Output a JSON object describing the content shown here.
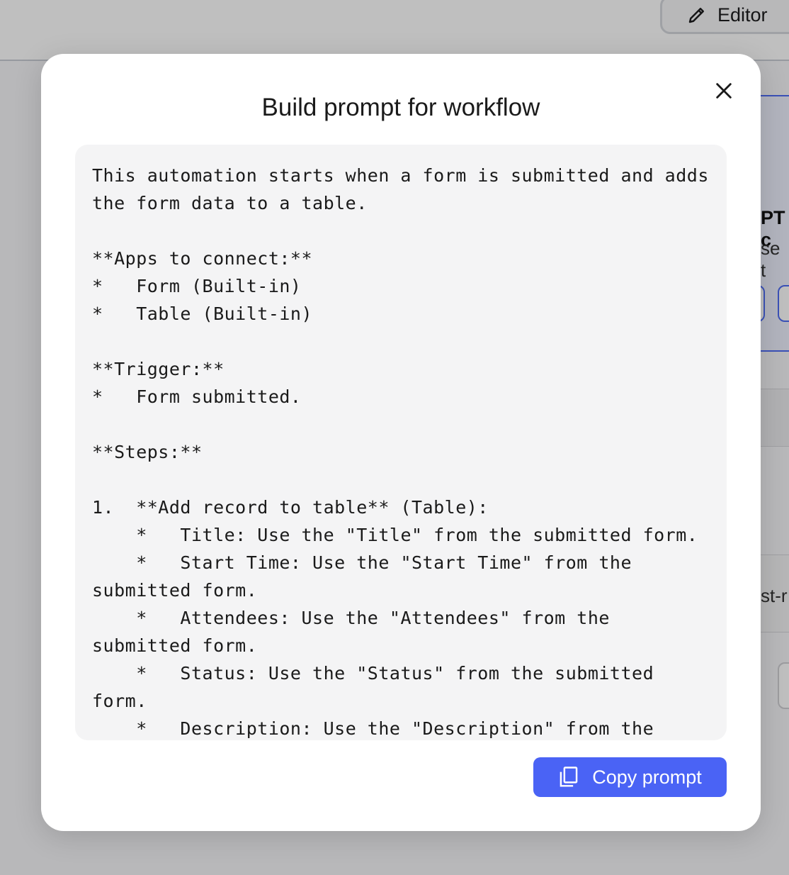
{
  "background": {
    "editor_button_label": "Editor",
    "card_title_fragment": "PT c",
    "card_sub_fragment": "se t",
    "code_fragment": "st-r"
  },
  "modal": {
    "title": "Build prompt for workflow",
    "prompt_lines": [
      "This automation starts when a form is submitted and adds the form data to a table.",
      "",
      "**Apps to connect:**",
      "*   Form (Built-in)",
      "*   Table (Built-in)",
      "",
      "**Trigger:**",
      "*   Form submitted.",
      "",
      "**Steps:**",
      "",
      "1.  **Add record to table** (Table):",
      "    *   Title: Use the \"Title\" from the submitted form.",
      "    *   Start Time: Use the \"Start Time\" from the submitted form.",
      "    *   Attendees: Use the \"Attendees\" from the submitted form.",
      "    *   Status: Use the \"Status\" from the submitted form.",
      "    *   Description: Use the \"Description\" from the"
    ],
    "copy_button_label": "Copy prompt"
  },
  "colors": {
    "accent": "#4a63f5",
    "overlay": "#000000",
    "prompt_bg": "#f4f4f5"
  },
  "icons": {
    "editor": "pencil-icon",
    "close": "close-icon",
    "copy": "copy-icon"
  }
}
